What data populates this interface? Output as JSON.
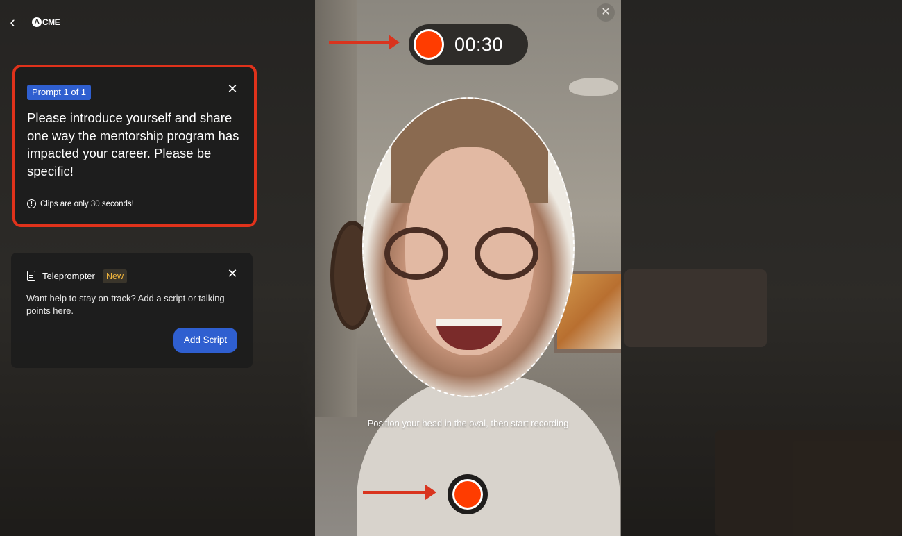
{
  "header": {
    "back_icon": "chevron-left-icon",
    "logo_mark": "A",
    "logo_text": "CME"
  },
  "prompt_card": {
    "badge": "Prompt 1 of 1",
    "text": "Please introduce yourself and share one way the mentorship program has impacted your career. Please be specific!",
    "note": "Clips are only 30 seconds!",
    "close_icon": "close-icon",
    "highlight_color": "#e0321b"
  },
  "teleprompter": {
    "title": "Teleprompter",
    "new_badge": "New",
    "description": "Want help to stay on-track? Add a script or talking points here.",
    "button": "Add Script",
    "close_icon": "close-icon"
  },
  "camera": {
    "timer": "00:30",
    "hint": "Position your head in the oval, then start recording",
    "record_color": "#ff3c00",
    "close_icon": "close-icon"
  },
  "annotations": {
    "arrow_color": "#d9341e"
  }
}
